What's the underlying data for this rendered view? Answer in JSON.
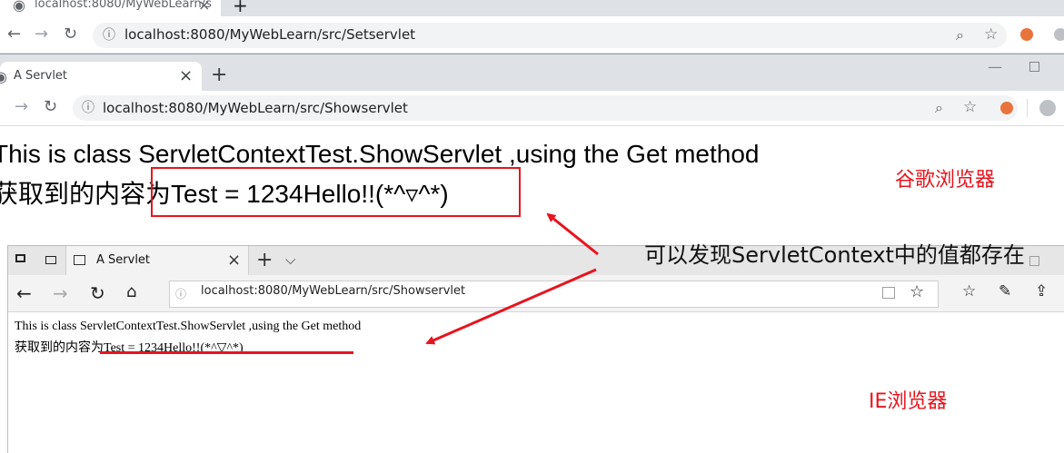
{
  "chrome_top": {
    "tab_title": "localhost:8080/MyWebLearn/s",
    "new_tab": "+",
    "url": "localhost:8080/MyWebLearn/src/Setservlet"
  },
  "chrome_main": {
    "tab_title": "A Servlet",
    "tab_close": "×",
    "new_tab": "+",
    "url": "localhost:8080/MyWebLearn/src/Showservlet",
    "line1": "This is class ServletContextTest.ShowServlet ,using the Get method",
    "line2_prefix": "获取到的内容为",
    "line2_value": "Test = 1234Hello!!(*^▿^*)"
  },
  "ie": {
    "tab_title": "A Servlet",
    "tab_close": "×",
    "new_tab": "+",
    "url": "localhost:8080/MyWebLearn/src/Showservlet",
    "line1": "This is class ServletContextTest.ShowServlet ,using the Get method",
    "line2_prefix": "获取到的内容为",
    "line2_value": "Test = 1234Hello!!(*^▽^*)"
  },
  "annotations": {
    "chrome_label": "谷歌浏览器",
    "ie_label": "IE浏览器",
    "note": "可以发现ServletContext中的值都存在"
  },
  "colors": {
    "annotation": "#e8141e"
  }
}
